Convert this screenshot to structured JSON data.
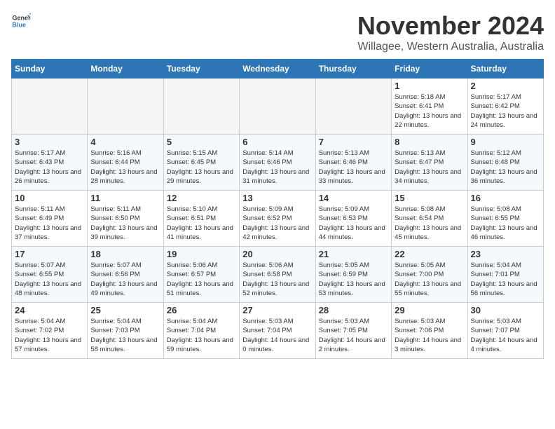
{
  "logo": {
    "text_general": "General",
    "text_blue": "Blue"
  },
  "title": "November 2024",
  "subtitle": "Willagee, Western Australia, Australia",
  "days_of_week": [
    "Sunday",
    "Monday",
    "Tuesday",
    "Wednesday",
    "Thursday",
    "Friday",
    "Saturday"
  ],
  "weeks": [
    [
      {
        "day": "",
        "empty": true
      },
      {
        "day": "",
        "empty": true
      },
      {
        "day": "",
        "empty": true
      },
      {
        "day": "",
        "empty": true
      },
      {
        "day": "",
        "empty": true
      },
      {
        "day": "1",
        "info": "Sunrise: 5:18 AM\nSunset: 6:41 PM\nDaylight: 13 hours\nand 22 minutes."
      },
      {
        "day": "2",
        "info": "Sunrise: 5:17 AM\nSunset: 6:42 PM\nDaylight: 13 hours\nand 24 minutes."
      }
    ],
    [
      {
        "day": "3",
        "info": "Sunrise: 5:17 AM\nSunset: 6:43 PM\nDaylight: 13 hours\nand 26 minutes."
      },
      {
        "day": "4",
        "info": "Sunrise: 5:16 AM\nSunset: 6:44 PM\nDaylight: 13 hours\nand 28 minutes."
      },
      {
        "day": "5",
        "info": "Sunrise: 5:15 AM\nSunset: 6:45 PM\nDaylight: 13 hours\nand 29 minutes."
      },
      {
        "day": "6",
        "info": "Sunrise: 5:14 AM\nSunset: 6:46 PM\nDaylight: 13 hours\nand 31 minutes."
      },
      {
        "day": "7",
        "info": "Sunrise: 5:13 AM\nSunset: 6:46 PM\nDaylight: 13 hours\nand 33 minutes."
      },
      {
        "day": "8",
        "info": "Sunrise: 5:13 AM\nSunset: 6:47 PM\nDaylight: 13 hours\nand 34 minutes."
      },
      {
        "day": "9",
        "info": "Sunrise: 5:12 AM\nSunset: 6:48 PM\nDaylight: 13 hours\nand 36 minutes."
      }
    ],
    [
      {
        "day": "10",
        "info": "Sunrise: 5:11 AM\nSunset: 6:49 PM\nDaylight: 13 hours\nand 37 minutes."
      },
      {
        "day": "11",
        "info": "Sunrise: 5:11 AM\nSunset: 6:50 PM\nDaylight: 13 hours\nand 39 minutes."
      },
      {
        "day": "12",
        "info": "Sunrise: 5:10 AM\nSunset: 6:51 PM\nDaylight: 13 hours\nand 41 minutes."
      },
      {
        "day": "13",
        "info": "Sunrise: 5:09 AM\nSunset: 6:52 PM\nDaylight: 13 hours\nand 42 minutes."
      },
      {
        "day": "14",
        "info": "Sunrise: 5:09 AM\nSunset: 6:53 PM\nDaylight: 13 hours\nand 44 minutes."
      },
      {
        "day": "15",
        "info": "Sunrise: 5:08 AM\nSunset: 6:54 PM\nDaylight: 13 hours\nand 45 minutes."
      },
      {
        "day": "16",
        "info": "Sunrise: 5:08 AM\nSunset: 6:55 PM\nDaylight: 13 hours\nand 46 minutes."
      }
    ],
    [
      {
        "day": "17",
        "info": "Sunrise: 5:07 AM\nSunset: 6:55 PM\nDaylight: 13 hours\nand 48 minutes."
      },
      {
        "day": "18",
        "info": "Sunrise: 5:07 AM\nSunset: 6:56 PM\nDaylight: 13 hours\nand 49 minutes."
      },
      {
        "day": "19",
        "info": "Sunrise: 5:06 AM\nSunset: 6:57 PM\nDaylight: 13 hours\nand 51 minutes."
      },
      {
        "day": "20",
        "info": "Sunrise: 5:06 AM\nSunset: 6:58 PM\nDaylight: 13 hours\nand 52 minutes."
      },
      {
        "day": "21",
        "info": "Sunrise: 5:05 AM\nSunset: 6:59 PM\nDaylight: 13 hours\nand 53 minutes."
      },
      {
        "day": "22",
        "info": "Sunrise: 5:05 AM\nSunset: 7:00 PM\nDaylight: 13 hours\nand 55 minutes."
      },
      {
        "day": "23",
        "info": "Sunrise: 5:04 AM\nSunset: 7:01 PM\nDaylight: 13 hours\nand 56 minutes."
      }
    ],
    [
      {
        "day": "24",
        "info": "Sunrise: 5:04 AM\nSunset: 7:02 PM\nDaylight: 13 hours\nand 57 minutes."
      },
      {
        "day": "25",
        "info": "Sunrise: 5:04 AM\nSunset: 7:03 PM\nDaylight: 13 hours\nand 58 minutes."
      },
      {
        "day": "26",
        "info": "Sunrise: 5:04 AM\nSunset: 7:04 PM\nDaylight: 13 hours\nand 59 minutes."
      },
      {
        "day": "27",
        "info": "Sunrise: 5:03 AM\nSunset: 7:04 PM\nDaylight: 14 hours\nand 0 minutes."
      },
      {
        "day": "28",
        "info": "Sunrise: 5:03 AM\nSunset: 7:05 PM\nDaylight: 14 hours\nand 2 minutes."
      },
      {
        "day": "29",
        "info": "Sunrise: 5:03 AM\nSunset: 7:06 PM\nDaylight: 14 hours\nand 3 minutes."
      },
      {
        "day": "30",
        "info": "Sunrise: 5:03 AM\nSunset: 7:07 PM\nDaylight: 14 hours\nand 4 minutes."
      }
    ]
  ]
}
